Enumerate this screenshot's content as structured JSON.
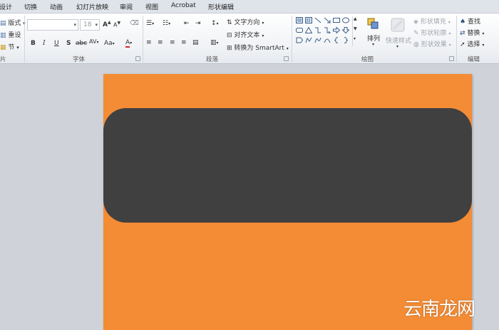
{
  "menubar": {
    "items": [
      "设计",
      "切换",
      "动画",
      "幻灯片放映",
      "审阅",
      "视图",
      "Acrobat",
      "形状编辑"
    ]
  },
  "slides_group": {
    "layout_label": "版式",
    "reset_label": "重设",
    "section_label": "节"
  },
  "font_group": {
    "label": "字体",
    "font_name_placeholder": "",
    "font_size": "18",
    "bold": "B",
    "italic": "I",
    "underline": "U",
    "strike": "S",
    "shadow": "abc",
    "spacing": "AV",
    "case": "Aa",
    "color": "A",
    "grow": "A",
    "shrink": "A"
  },
  "paragraph_group": {
    "label": "段落",
    "text_direction": "文字方向",
    "align_text": "对齐文本",
    "smartart": "转换为 SmartArt"
  },
  "drawing_group": {
    "label": "绘图",
    "arrange": "排列",
    "quick_styles": "快速样式",
    "shape_fill": "形状填充",
    "shape_outline": "形状轮廓",
    "shape_effects": "形状效果"
  },
  "editing_group": {
    "label": "编辑",
    "find": "查找",
    "replace": "替换",
    "select": "选择"
  },
  "slide": {
    "background_color": "#f48c35",
    "shape_color": "#404040"
  },
  "watermark": "云南龙网"
}
